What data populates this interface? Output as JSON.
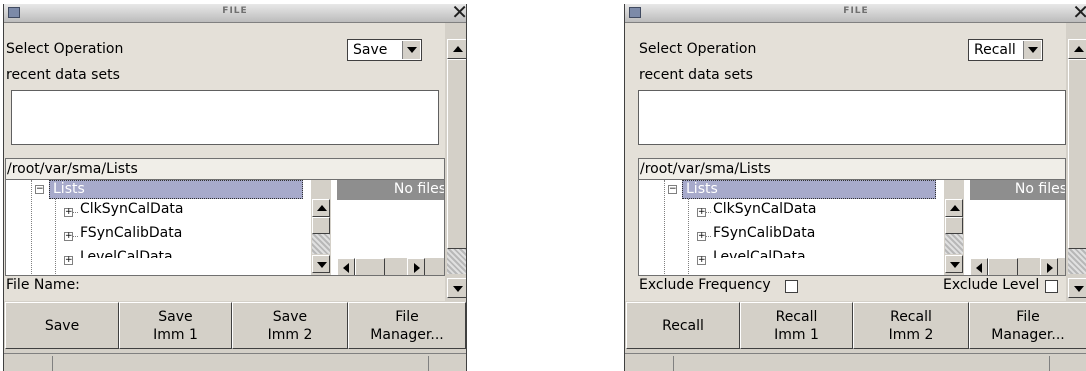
{
  "left_dialog": {
    "title": "FILE",
    "select_operation_label": "Select Operation",
    "operation_value": "Save",
    "recent_label": "recent data sets",
    "path": "/root/var/sma/Lists",
    "tree": {
      "root": "Lists",
      "children": [
        "ClkSynCalData",
        "FSynCalibData",
        "LevelCalData"
      ]
    },
    "files_header": "No files",
    "file_name_label": "File Name:",
    "buttons": [
      "Save",
      "Save\nImm 1",
      "Save\nImm 2",
      "File\nManager..."
    ]
  },
  "right_dialog": {
    "title": "FILE",
    "select_operation_label": "Select Operation",
    "operation_value": "Recall",
    "recent_label": "recent data sets",
    "path": "/root/var/sma/Lists",
    "tree": {
      "root": "Lists",
      "children": [
        "ClkSynCalData",
        "FSynCalibData",
        "LevelCalData"
      ]
    },
    "files_header": "No files",
    "exclude_frequency_label": "Exclude Frequency",
    "exclude_level_label": "Exclude Level",
    "buttons": [
      "Recall",
      "Recall\nImm 1",
      "Recall\nImm 2",
      "File\nManager..."
    ]
  }
}
